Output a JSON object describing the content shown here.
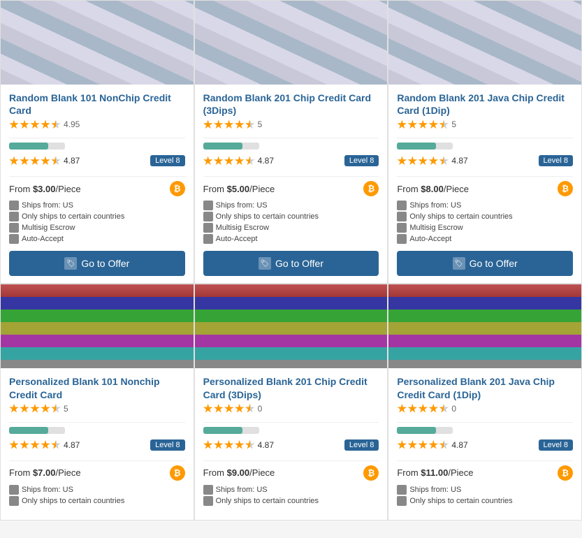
{
  "products": [
    {
      "id": "p1",
      "title": "Random Blank 101 NonChip Credit Card",
      "rating": 4.95,
      "review_count": null,
      "show_count": false,
      "seller_rating": 4.87,
      "level": "Level 8",
      "price": "$3.00",
      "unit": "/Piece",
      "ships_from": "US",
      "only_ships": true,
      "multisig": true,
      "auto_accept": true,
      "has_button": true,
      "image_type": "blank",
      "row": 1
    },
    {
      "id": "p2",
      "title": "Random Blank 201 Chip Credit Card (3Dips)",
      "rating": null,
      "review_count": 5,
      "show_count": true,
      "seller_rating": 4.87,
      "level": "Level 8",
      "price": "$5.00",
      "unit": "/Piece",
      "ships_from": "US",
      "only_ships": true,
      "multisig": true,
      "auto_accept": true,
      "has_button": true,
      "image_type": "blank",
      "row": 1
    },
    {
      "id": "p3",
      "title": "Random Blank 201 Java Chip Credit Card (1Dip)",
      "rating": null,
      "review_count": 5,
      "show_count": true,
      "seller_rating": 4.87,
      "level": "Level 8",
      "price": "$8.00",
      "unit": "/Piece",
      "ships_from": "US",
      "only_ships": true,
      "multisig": true,
      "auto_accept": true,
      "has_button": true,
      "image_type": "blank",
      "row": 1
    },
    {
      "id": "p4",
      "title": "Personalized Blank 101 Nonchip Credit Card",
      "rating": null,
      "review_count": 5,
      "show_count": true,
      "seller_rating": 4.87,
      "level": "Level 8",
      "price": "$7.00",
      "unit": "/Piece",
      "ships_from": "US",
      "only_ships": true,
      "multisig": false,
      "auto_accept": false,
      "has_button": false,
      "image_type": "discover",
      "row": 2
    },
    {
      "id": "p5",
      "title": "Personalized Blank 201 Chip Credit Card (3Dips)",
      "rating": null,
      "review_count": 0,
      "show_count": true,
      "seller_rating": 4.87,
      "level": "Level 8",
      "price": "$9.00",
      "unit": "/Piece",
      "ships_from": "US",
      "only_ships": true,
      "multisig": false,
      "auto_accept": false,
      "has_button": false,
      "image_type": "discover",
      "row": 2
    },
    {
      "id": "p6",
      "title": "Personalized Blank 201 Java Chip Credit Card (1Dip)",
      "rating": null,
      "review_count": 0,
      "show_count": true,
      "seller_rating": 4.87,
      "level": "Level 8",
      "price": "$11.00",
      "unit": "/Piece",
      "ships_from": "US",
      "only_ships": true,
      "multisig": false,
      "auto_accept": false,
      "has_button": false,
      "image_type": "discover",
      "row": 2
    }
  ],
  "labels": {
    "from": "From",
    "ships_from": "Ships from: US",
    "only_ships": "Only ships to certain countries",
    "multisig": "Multisig Escrow",
    "auto_accept": "Auto-Accept",
    "go_to_offer": "Go to Offer",
    "level8": "Level 8"
  }
}
